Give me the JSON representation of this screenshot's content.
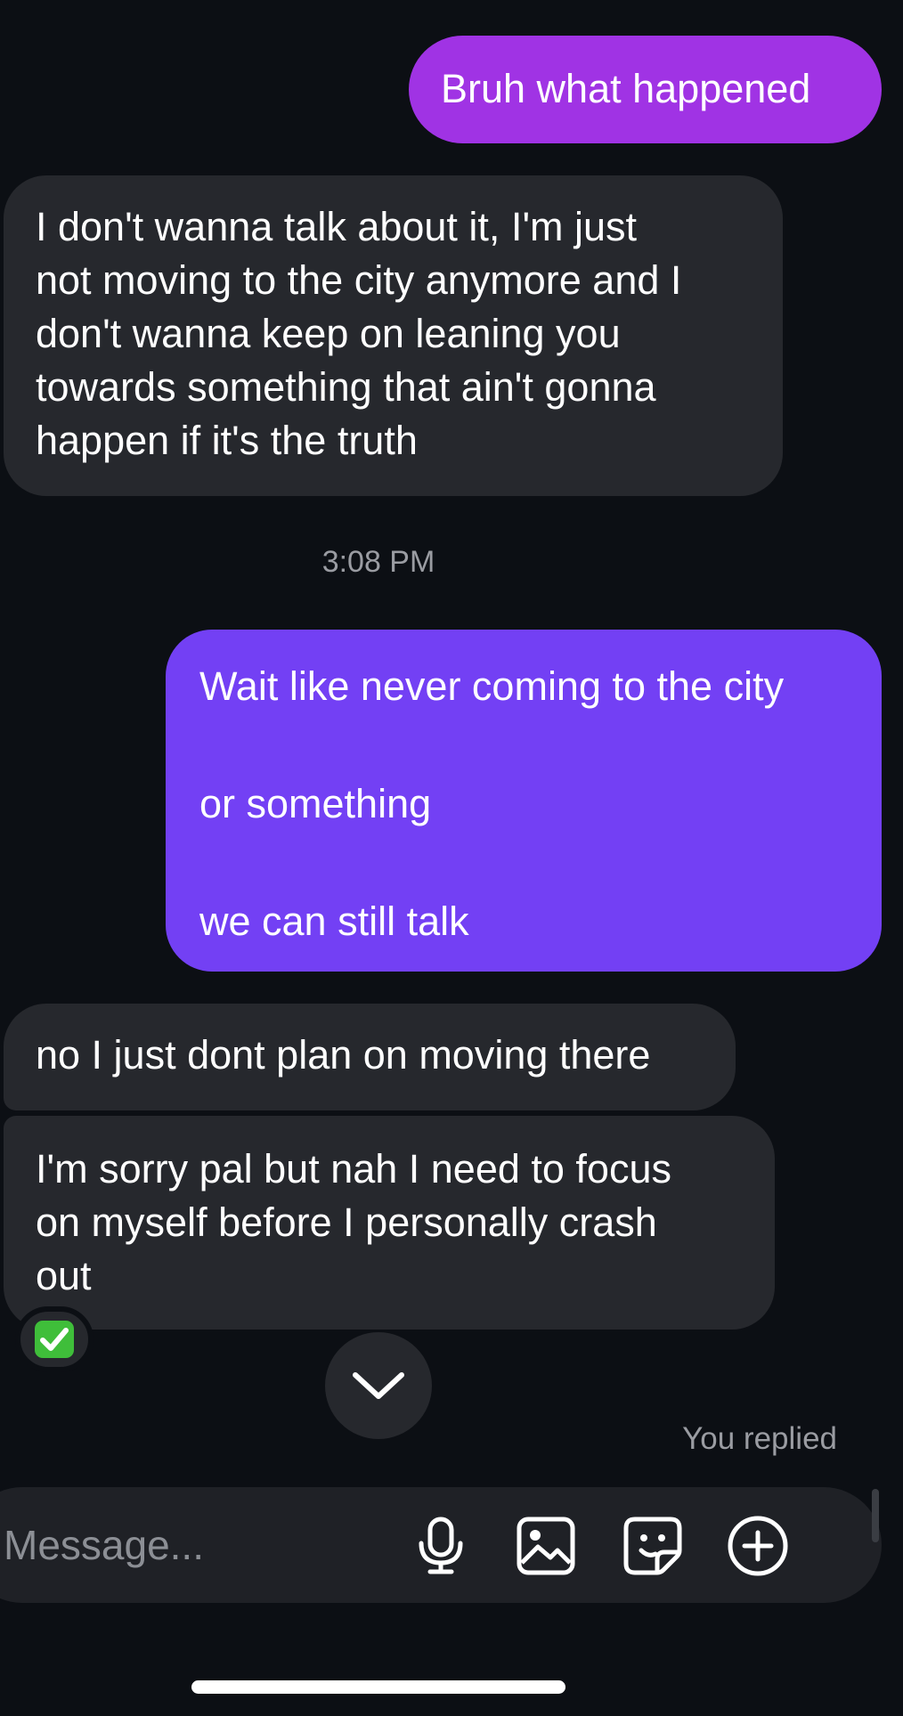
{
  "messages": {
    "m1": "Bruh what happened",
    "m2": [
      "I don't wanna talk about it, I'm just",
      "not moving to the city anymore and I",
      "don't wanna keep on leaning you",
      "towards something that ain't gonna",
      "happen if it's the truth"
    ],
    "timestamp": "3:08 PM",
    "m3": [
      "Wait like never coming to the city",
      "or something",
      "we can still talk"
    ],
    "m4": "no I just dont plan on moving there",
    "m5": [
      "I'm sorry pal but nah I need to focus",
      "on myself before I personally crash",
      "out"
    ]
  },
  "reaction": {
    "icon": "white-check-mark-emoji"
  },
  "status": {
    "you_replied": "You replied"
  },
  "composer": {
    "placeholder": "Message...",
    "icons": [
      "microphone-icon",
      "gallery-icon",
      "sticker-icon",
      "plus-circle-icon"
    ]
  },
  "colors": {
    "background": "#0c0f14",
    "incoming_bubble": "#26282d",
    "outgoing_bubble_1": "#a033e4",
    "outgoing_bubble_2": "#7340f4",
    "reaction_green": "#3fbe3a"
  }
}
